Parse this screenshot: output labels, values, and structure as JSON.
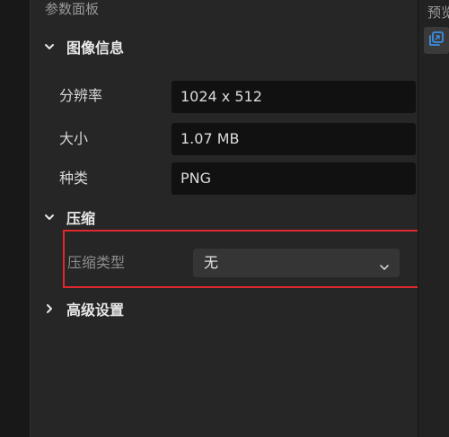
{
  "panel": {
    "title": "参数面板"
  },
  "sections": {
    "image_info": {
      "title": "图像信息",
      "rows": [
        {
          "label": "分辨率",
          "value": "1024 x 512"
        },
        {
          "label": "大小",
          "value": "1.07 MB"
        },
        {
          "label": "种类",
          "value": "PNG"
        }
      ]
    },
    "compression": {
      "title": "压缩",
      "type_label": "压缩类型",
      "type_value": "无"
    },
    "advanced": {
      "title": "高级设置"
    }
  },
  "right_panel": {
    "title": "预览"
  },
  "colors": {
    "highlight": "#e0282e",
    "preview_icon": "#3d8fe6"
  }
}
